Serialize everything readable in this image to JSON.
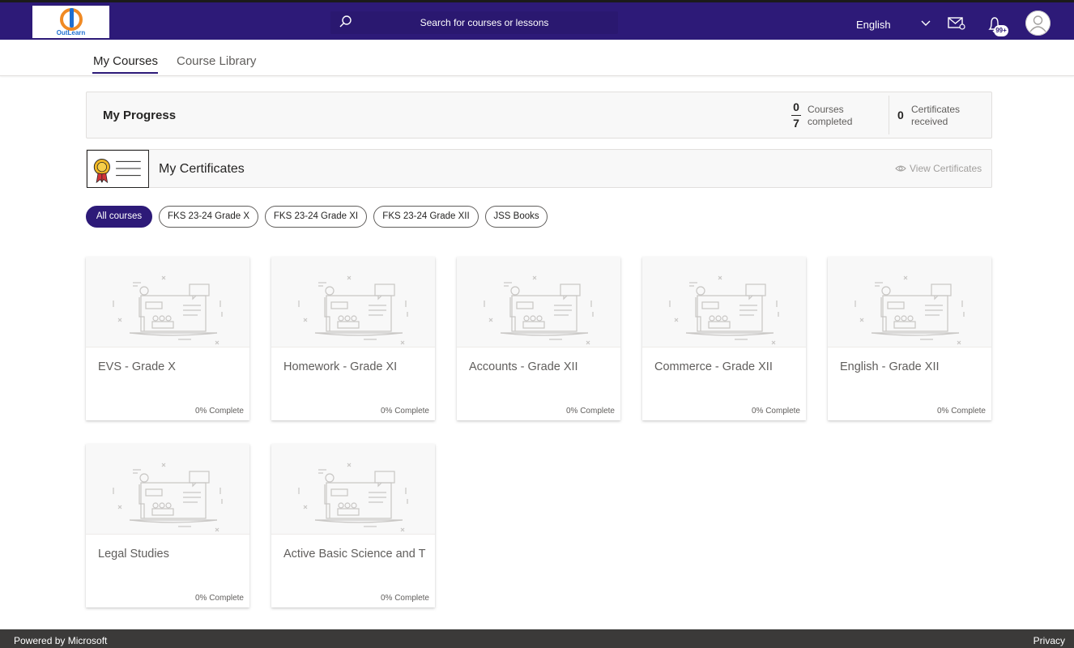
{
  "header": {
    "logo_text": "OutLearn",
    "search_placeholder": "Search for courses or lessons",
    "language": "English",
    "notification_badge": "99+"
  },
  "tabs": [
    {
      "label": "My Courses",
      "active": true
    },
    {
      "label": "Course Library",
      "active": false
    }
  ],
  "progress": {
    "title": "My Progress",
    "courses_completed": "0",
    "courses_total": "7",
    "courses_label_1": "Courses",
    "courses_label_2": "completed",
    "certificates_received": "0",
    "certificates_label_1": "Certificates",
    "certificates_label_2": "received"
  },
  "certificates": {
    "title": "My Certificates",
    "view_label": "View Certificates"
  },
  "filters": [
    {
      "label": "All courses",
      "active": true
    },
    {
      "label": "FKS 23-24 Grade X",
      "active": false
    },
    {
      "label": "FKS 23-24 Grade XI",
      "active": false
    },
    {
      "label": "FKS 23-24 Grade XII",
      "active": false
    },
    {
      "label": "JSS Books",
      "active": false
    }
  ],
  "courses": [
    {
      "title": "EVS - Grade X",
      "progress": "0% Complete"
    },
    {
      "title": "Homework - Grade XI",
      "progress": "0% Complete"
    },
    {
      "title": "Accounts - Grade XII",
      "progress": "0% Complete"
    },
    {
      "title": "Commerce - Grade XII",
      "progress": "0% Complete"
    },
    {
      "title": "English - Grade XII",
      "progress": "0% Complete"
    },
    {
      "title": "Legal Studies",
      "progress": "0% Complete"
    },
    {
      "title": "Active Basic Science and T",
      "progress": "0% Complete"
    }
  ],
  "footer": {
    "powered_by": "Powered by Microsoft",
    "privacy": "Privacy"
  },
  "colors": {
    "brand": "#2d1a78",
    "footer": "#3b3a39",
    "logo_orange": "#f08a24",
    "logo_blue": "#1f6fd1"
  }
}
